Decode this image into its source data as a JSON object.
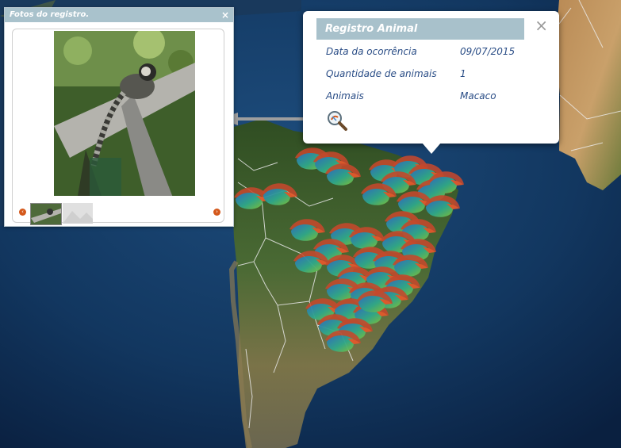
{
  "photo_panel": {
    "title": "Fotos do registro.",
    "close": "×",
    "prev": "‹",
    "next": "›",
    "thumbnails": [
      "thumb-marmoset",
      "thumb-placeholder"
    ]
  },
  "popup": {
    "title": "Registro Animal",
    "close": "×",
    "rows": [
      {
        "label": "Data da ocorrência",
        "value": "09/07/2015"
      },
      {
        "label": "Quantidade de animais",
        "value": "1"
      },
      {
        "label": "Animais",
        "value": "Macaco"
      }
    ],
    "zoom_icon": "magnifier-icon"
  },
  "colors": {
    "header": "#a8c1cb",
    "text_blue": "#2a4d86",
    "nav_orange": "#d4591c",
    "ocean": "#0e2a4a",
    "land": "#3d5a2a"
  },
  "map": {
    "marker_icon": "animal-marker-icon",
    "marker_count": 40
  }
}
